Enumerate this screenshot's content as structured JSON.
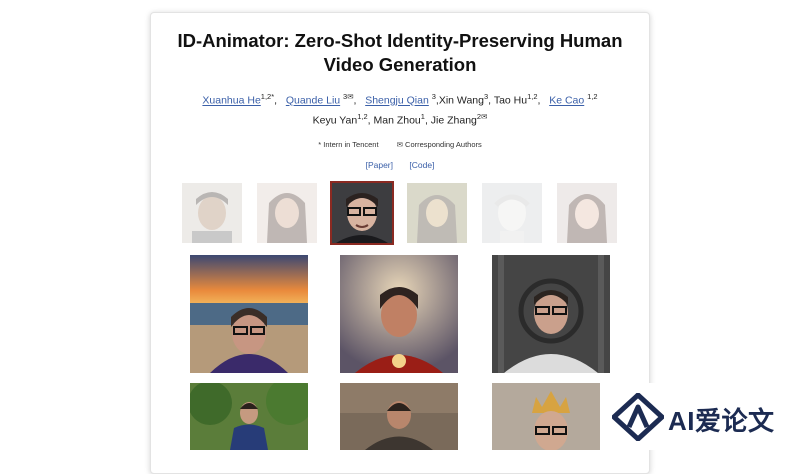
{
  "paper": {
    "title": "ID-Animator: Zero-Shot Identity-Preserving Human Video Generation",
    "authors": [
      {
        "name": "Xuanhua He",
        "sup": "1,2*",
        "link": true
      },
      {
        "name": "Quande Liu",
        "sup": "3✉",
        "link": true
      },
      {
        "name": "Shengju Qian",
        "sup": "3",
        "link": true
      },
      {
        "name": "Xin Wang",
        "sup": "3",
        "link": false
      },
      {
        "name": "Tao Hu",
        "sup": "1,2",
        "link": false
      },
      {
        "name": "Ke Cao",
        "sup": "1,2",
        "link": true
      },
      {
        "name": "Keyu Yan",
        "sup": "1,2",
        "link": false
      },
      {
        "name": "Man Zhou",
        "sup": "1",
        "link": false
      },
      {
        "name": "Jie Zhang",
        "sup": "2✉",
        "link": false
      }
    ],
    "note_intern": "* Intern in Tencent",
    "note_corresponding": "✉ Corresponding Authors",
    "links": {
      "paper": "[Paper]",
      "code": "[Code]"
    }
  },
  "reference_faces": [
    {
      "name": "face-1"
    },
    {
      "name": "face-2"
    },
    {
      "name": "face-3",
      "selected": true
    },
    {
      "name": "face-4"
    },
    {
      "name": "face-5"
    },
    {
      "name": "face-6"
    }
  ],
  "watermark": {
    "text": "AI爱论文",
    "icon": "ai-logo-icon",
    "color": "#1c2b52"
  }
}
